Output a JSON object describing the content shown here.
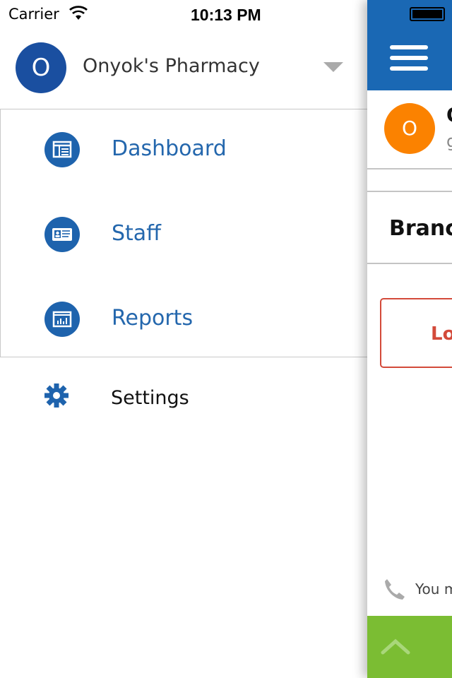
{
  "status_bar": {
    "carrier": "Carrier",
    "time": "10:13 PM"
  },
  "drawer": {
    "account": {
      "avatar_letter": "O",
      "name": "Onyok's Pharmacy"
    },
    "menu": [
      {
        "label": "Dashboard",
        "icon": "dashboard-icon"
      },
      {
        "label": "Staff",
        "icon": "id-card-icon"
      },
      {
        "label": "Reports",
        "icon": "report-chart-icon"
      }
    ],
    "settings": {
      "label": "Settings",
      "icon": "gear-icon"
    }
  },
  "panel": {
    "avatar_letter": "O",
    "title": "O",
    "subtitle": "g",
    "branch": "Branc",
    "logout": "Lo",
    "footer_text": "You m",
    "colors": {
      "header": "#1a68b4",
      "avatar": "#fb8200",
      "logout": "#d34a3a",
      "footer": "#7bbd33"
    }
  }
}
